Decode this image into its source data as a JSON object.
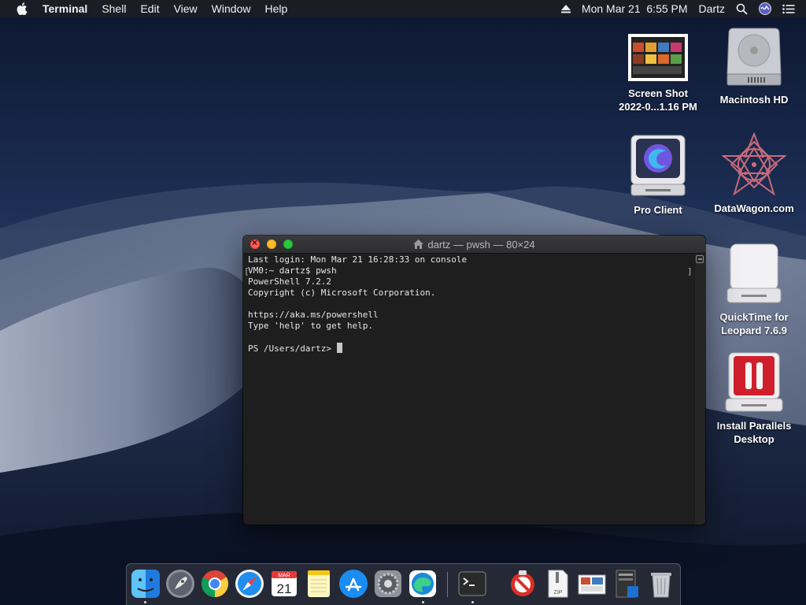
{
  "menubar": {
    "apple_icon": "apple-logo-icon",
    "app_name": "Terminal",
    "menus": [
      "Shell",
      "Edit",
      "View",
      "Window",
      "Help"
    ],
    "datetime": "Mon Mar 21  6:55 PM",
    "user": "Dartz",
    "status_icons": [
      "eject-icon",
      "search-icon",
      "siri-icon",
      "control-center-icon"
    ]
  },
  "desktop_icons": [
    {
      "label": "Screen Shot\n2022-0...1.16 PM",
      "icon": "screenshot-thumbnail-icon"
    },
    {
      "label": "Macintosh HD",
      "icon": "hard-drive-icon"
    },
    {
      "label": "Pro Client",
      "icon": "pro-client-disk-icon"
    },
    {
      "label": "DataWagon.com",
      "icon": "datawagon-icon"
    },
    {
      "label": "QuickTime for\nLeopard 7.6.9",
      "icon": "removable-disk-icon"
    },
    {
      "label": "Install Parallels\nDesktop",
      "icon": "parallels-disk-icon"
    }
  ],
  "terminal": {
    "title": "dartz — pwsh — 80×24",
    "lines": [
      "Last login: Mon Mar 21 16:28:33 on console",
      "VM0:~ dartz$ pwsh",
      "PowerShell 7.2.2",
      "Copyright (c) Microsoft Corporation.",
      "",
      "https://aka.ms/powershell",
      "Type 'help' to get help.",
      ""
    ],
    "prompt": "PS /Users/dartz> "
  },
  "dock": {
    "apps": [
      "finder-icon",
      "launchpad-icon",
      "chrome-icon",
      "safari-icon",
      "calendar-icon",
      "notes-icon",
      "app-store-icon",
      "system-preferences-icon",
      "edge-icon",
      "terminal-icon",
      "parallels-stop-icon",
      "zip-archive-icon",
      "screenshot-preview-icon",
      "document-stack-icon",
      "trash-icon"
    ],
    "calendar_month": "MAR",
    "calendar_day": "21",
    "zip_label": "ZIP"
  },
  "colors": {
    "close": "#fe5f57",
    "minimize": "#febc2e",
    "maximize": "#28c840",
    "terminal_bg": "#1e1e1e",
    "menubar_bg": "#1c1e24"
  }
}
